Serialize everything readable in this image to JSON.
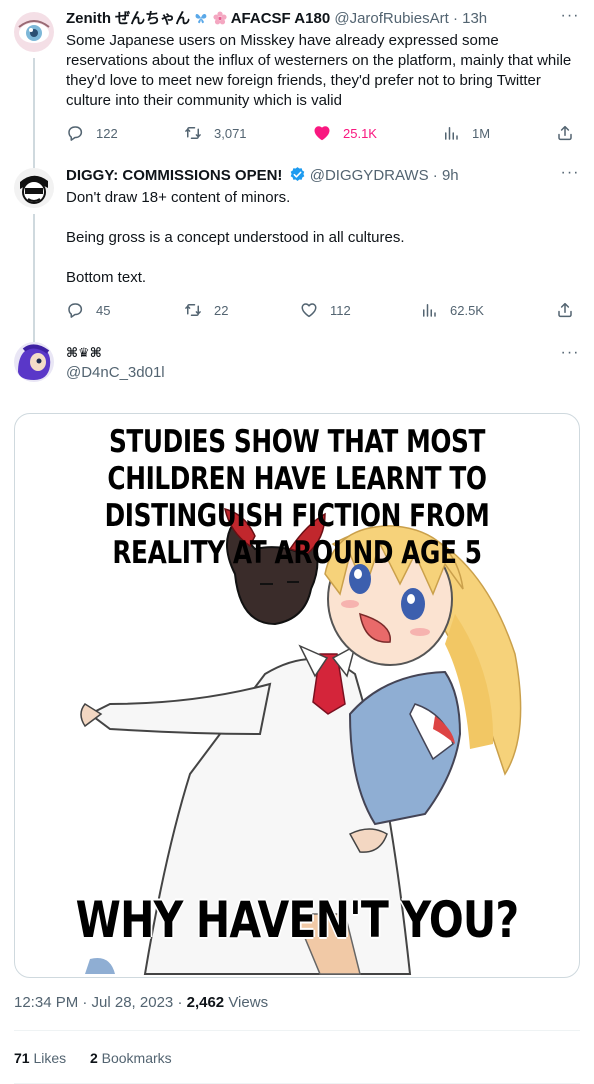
{
  "tweet1": {
    "display_name": "Zenith ぜんちゃん",
    "badge_text": "AFACSF A180",
    "handle": "@JarofRubiesArt",
    "separator": "·",
    "time": "13h",
    "text": "Some Japanese users on Misskey have already expressed some reservations about the influx of westerners on the platform, mainly that while they'd love to meet new foreign friends, they'd prefer not to bring Twitter culture into their community which is valid",
    "replies": "122",
    "retweets": "3,071",
    "likes": "25.1K",
    "views": "1M",
    "like_color": "#f91880"
  },
  "tweet2": {
    "display_name": "DIGGY: COMMISSIONS OPEN!",
    "handle": "@DIGGYDRAWS",
    "separator": "·",
    "time": "9h",
    "lines": [
      "Don't draw 18+ content of minors.",
      "Being gross is a concept understood in all cultures.",
      "Bottom text."
    ],
    "replies": "45",
    "retweets": "22",
    "likes": "112",
    "views": "62.5K",
    "verified_color": "#1d9bf0"
  },
  "tweet3": {
    "display_name": "⌘♛⌘",
    "handle": "@D4nC_3d01l",
    "meme": {
      "top_text": "STUDIES SHOW THAT MOST CHILDREN HAVE LEARNT TO DISTINGUISH FICTION FROM REALITY AT AROUND AGE 5",
      "bottom_text": "WHY HAVEN'T YOU?"
    },
    "timestamp": "12:34 PM · Jul 28, 2023",
    "meta_separator": "·",
    "views_count": "2,462",
    "views_label": "Views",
    "likes_count": "71",
    "likes_label": "Likes",
    "bookmarks_count": "2",
    "bookmarks_label": "Bookmarks"
  },
  "icons": {
    "more": "more-icon",
    "reply": "reply-icon",
    "retweet": "retweet-icon",
    "like": "heart-icon",
    "views": "analytics-icon",
    "share": "share-icon"
  },
  "colors": {
    "text_primary": "#0f1419",
    "text_secondary": "#536471",
    "border": "#cfd9de",
    "accent": "#1d9bf0"
  }
}
